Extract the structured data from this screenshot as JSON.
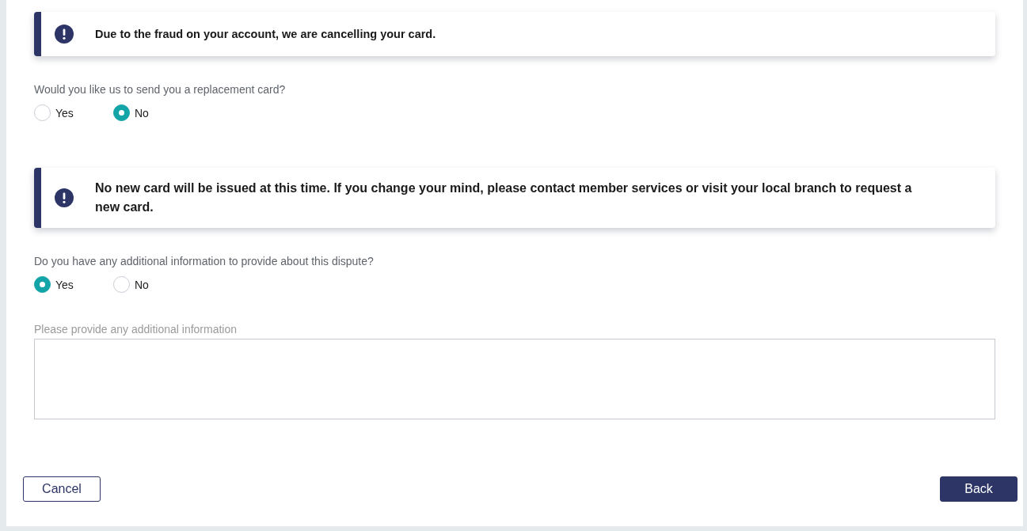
{
  "form": {
    "items": [
      {
        "kind": "alert_compact",
        "text": "Due to the fraud on your account, we are cancelling your card."
      },
      {
        "kind": "radio_question",
        "label": "Would you like us to send you a replacement card?",
        "options": [
          {
            "label": "Yes",
            "selected": false
          },
          {
            "label": "No",
            "selected": true
          }
        ]
      },
      {
        "kind": "alert",
        "text": "No new card will be issued at this time. If you change your mind, please contact member services or visit your local branch to request a new card."
      },
      {
        "kind": "radio_question",
        "label": "Do you have any additional information to provide about this dispute?",
        "options": [
          {
            "label": "Yes",
            "selected": true
          },
          {
            "label": "No",
            "selected": false
          }
        ]
      },
      {
        "kind": "text_area",
        "label": "Please provide any additional information"
      }
    ]
  },
  "buttons": [
    {
      "kind": "secondary",
      "label": "Cancel"
    },
    {
      "kind": "primary",
      "label": "Back"
    }
  ]
}
